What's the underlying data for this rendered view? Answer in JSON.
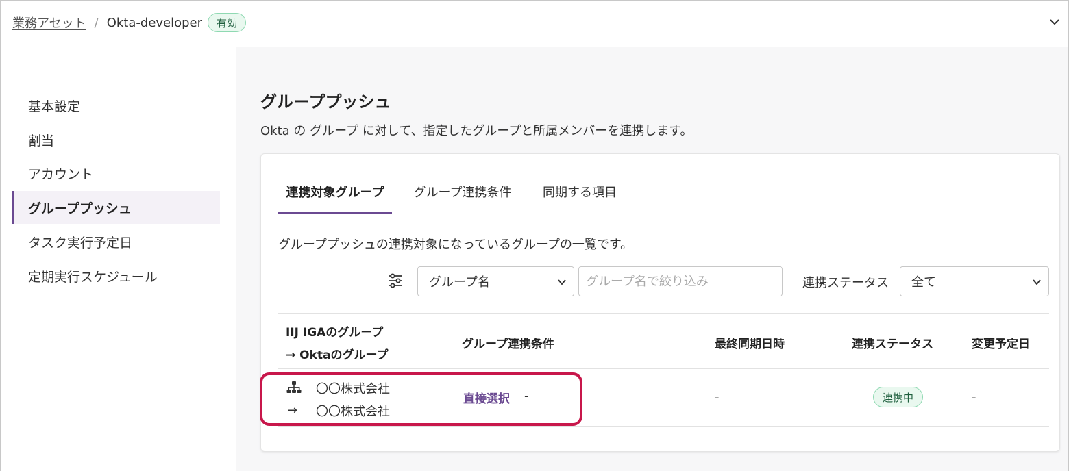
{
  "breadcrumb": {
    "parent": "業務アセット",
    "separator": "/",
    "current": "Okta-developer",
    "badge": "有効"
  },
  "icons": {
    "header_toggle": "chevron-down-icon",
    "filter": "sliders-icon",
    "group": "hierarchy-icon"
  },
  "sidebar": {
    "items": [
      {
        "label": "基本設定"
      },
      {
        "label": "割当"
      },
      {
        "label": "アカウント"
      },
      {
        "label": "グループプッシュ"
      },
      {
        "label": "タスク実行予定日"
      },
      {
        "label": "定期実行スケジュール"
      }
    ],
    "active_index": 3
  },
  "main": {
    "title": "グループプッシュ",
    "description": "Okta の グループ に対して、指定したグループと所属メンバーを連携します。",
    "tabs": [
      {
        "label": "連携対象グループ",
        "active": true
      },
      {
        "label": "グループ連携条件",
        "active": false
      },
      {
        "label": "同期する項目",
        "active": false
      }
    ],
    "list_description": "グループプッシュの連携対象になっているグループの一覧です。",
    "filter": {
      "field_select": "グループ名",
      "search_placeholder": "グループ名で絞り込み",
      "status_label": "連携ステータス",
      "status_select": "全て"
    },
    "table": {
      "columns": {
        "group_line1": "IIJ IGAのグループ",
        "group_line2": "→ Oktaのグループ",
        "condition": "グループ連携条件",
        "last_sync": "最終同期日時",
        "status": "連携ステータス",
        "scheduled": "変更予定日"
      },
      "rows": [
        {
          "iga_group": "〇〇株式会社",
          "arrow": "→",
          "okta_group": "〇〇株式会社",
          "condition_link": "直接選択",
          "condition_suffix": "-",
          "last_sync": "-",
          "status": "連携中",
          "scheduled": "-"
        }
      ]
    }
  },
  "colors": {
    "accent": "#6b4a92",
    "active_badge_bg": "#e9f8ef",
    "active_badge_border": "#8fd9b2",
    "highlight": "#c8174b"
  }
}
